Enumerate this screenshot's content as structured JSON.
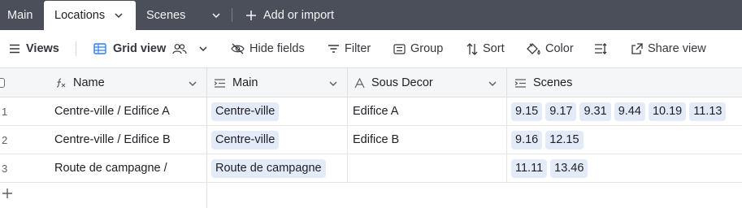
{
  "tabs": {
    "main": "Main",
    "locations": "Locations",
    "scenes": "Scenes",
    "add_or_import": "Add or import"
  },
  "toolbar": {
    "views": "Views",
    "grid_view": "Grid view",
    "hide_fields": "Hide fields",
    "filter": "Filter",
    "group": "Group",
    "sort": "Sort",
    "color": "Color",
    "share_view": "Share view"
  },
  "columns": {
    "name": "Name",
    "main": "Main",
    "sous_decor": "Sous Decor",
    "scenes": "Scenes"
  },
  "rows": [
    {
      "num": "1",
      "name": "Centre-ville / Edifice A",
      "main": "Centre-ville",
      "sous_decor": "Edifice A",
      "scenes": [
        "9.15",
        "9.17",
        "9.31",
        "9.44",
        "10.19",
        "11.13"
      ]
    },
    {
      "num": "2",
      "name": "Centre-ville / Edifice B",
      "main": "Centre-ville",
      "sous_decor": "Edifice B",
      "scenes": [
        "9.16",
        "12.15"
      ]
    },
    {
      "num": "3",
      "name": "Route de campagne /",
      "main": "Route de campagne",
      "sous_decor": "",
      "scenes": [
        "11.11",
        "13.46"
      ]
    }
  ],
  "colors": {
    "tabbar_bg": "#4a4f59",
    "chip_bg": "#e4ebf8",
    "grid_icon": "#2d7ff9"
  }
}
